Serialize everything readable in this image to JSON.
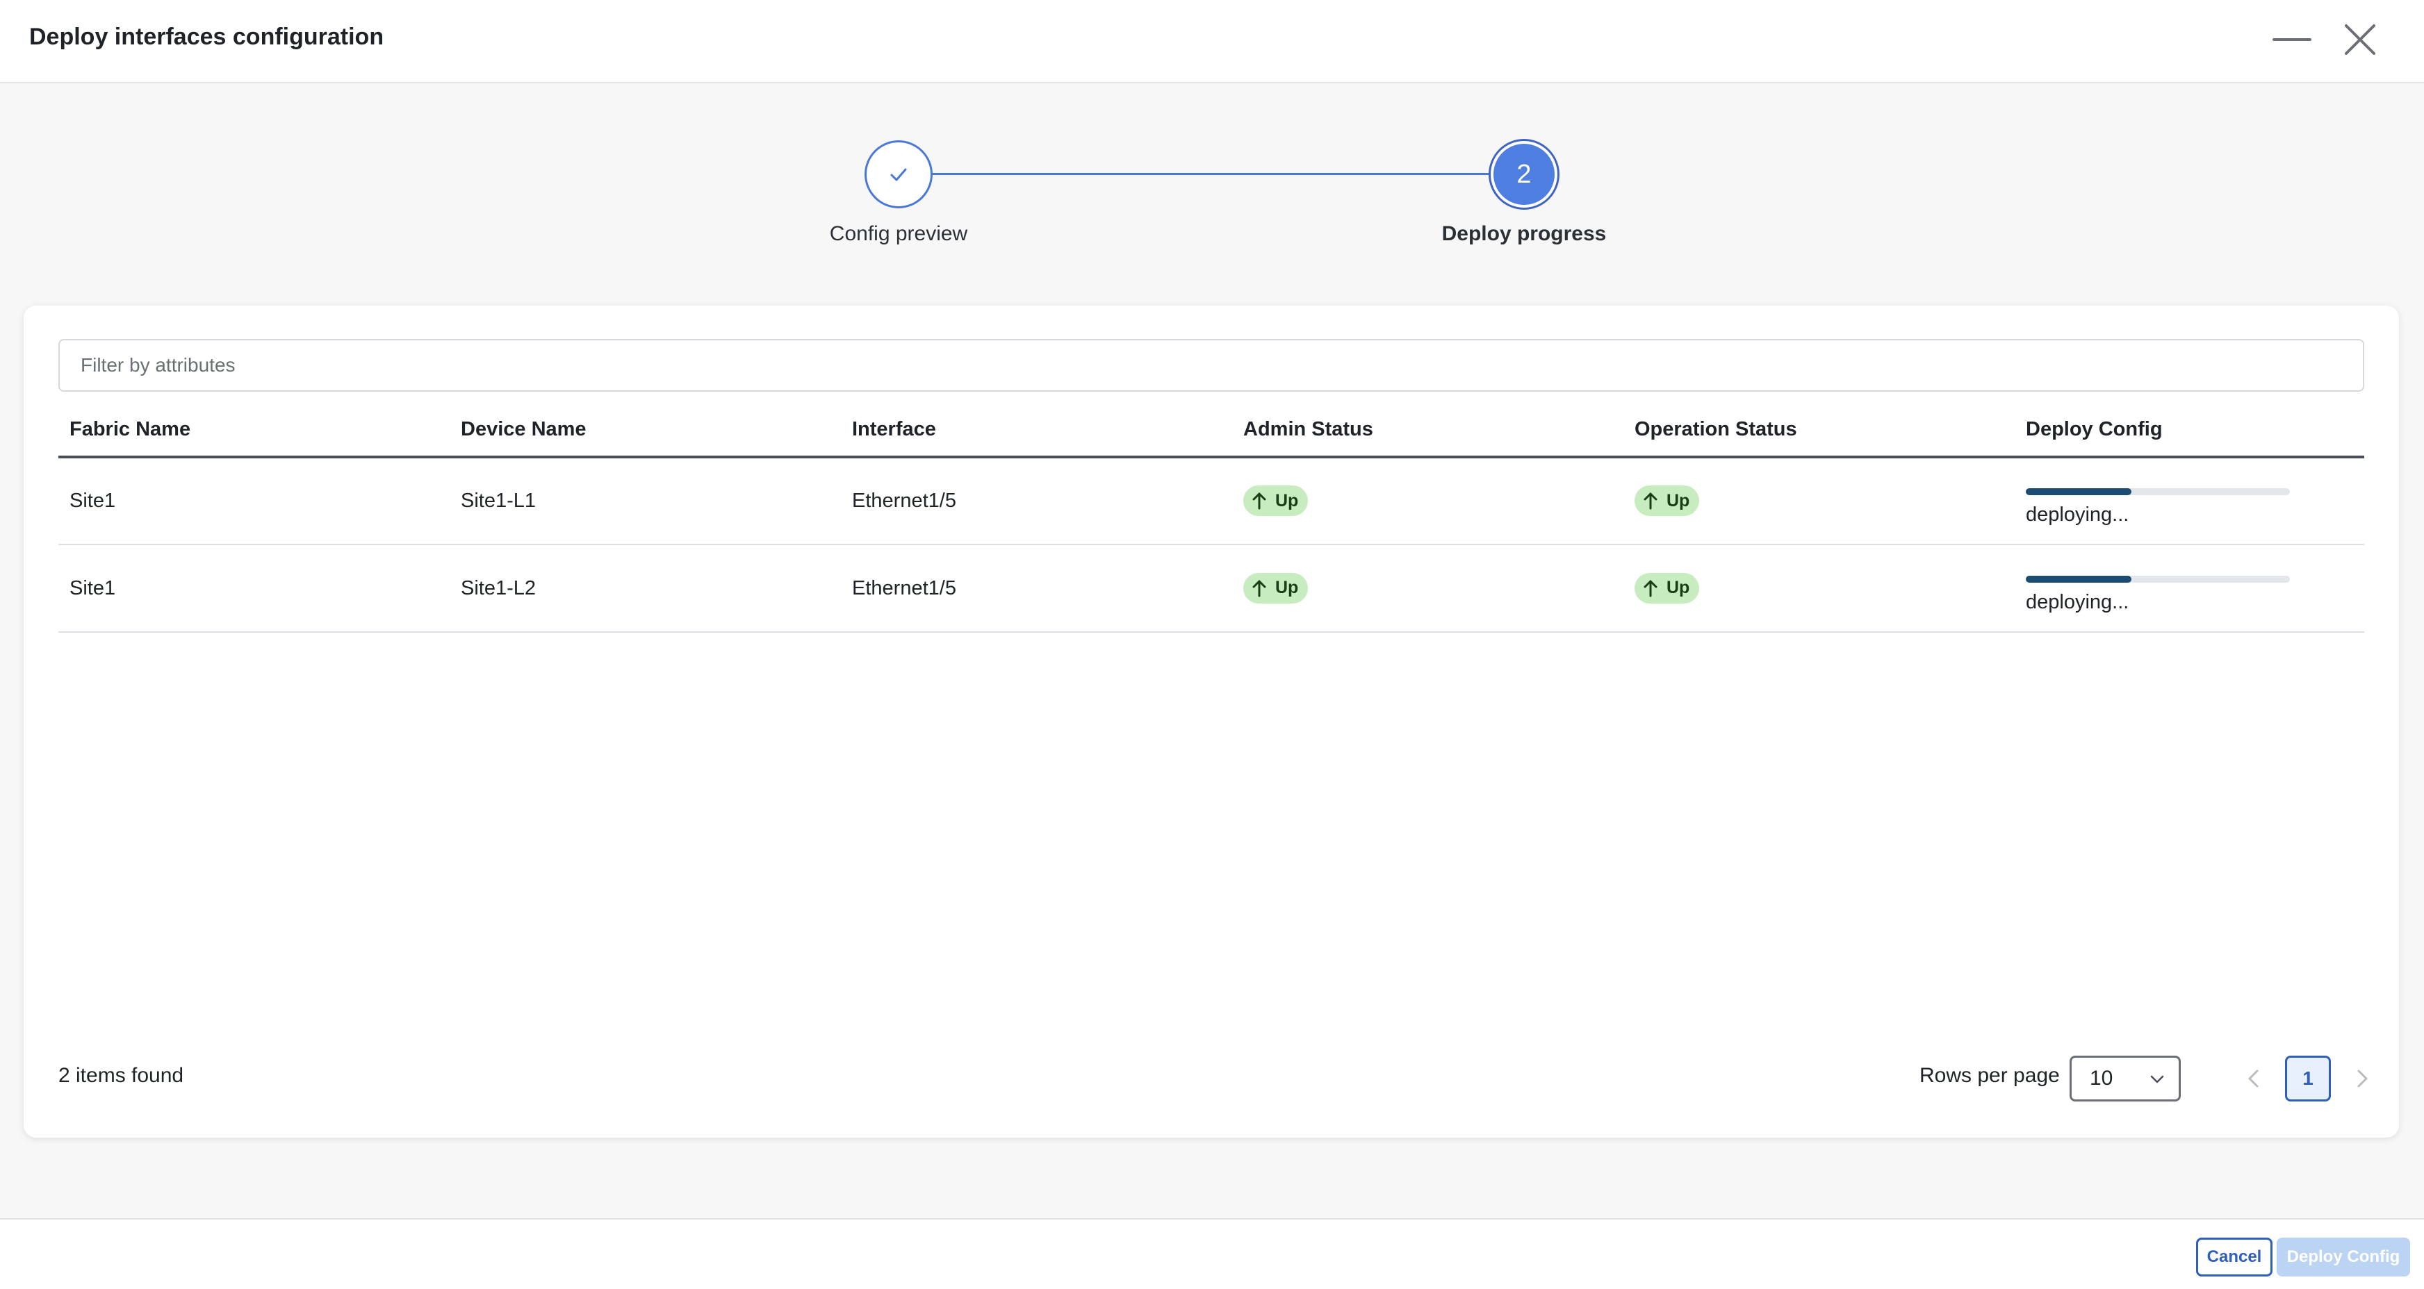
{
  "dialog": {
    "title": "Deploy interfaces configuration",
    "minimize_icon": "minimize-icon",
    "close_icon": "close-icon"
  },
  "stepper": {
    "steps": [
      {
        "label": "Config preview",
        "state": "completed",
        "icon": "checkmark-icon"
      },
      {
        "label": "Deploy progress",
        "state": "active",
        "number": "2"
      }
    ]
  },
  "filter": {
    "placeholder": "Filter by attributes",
    "value": ""
  },
  "table": {
    "columns": [
      "Fabric Name",
      "Device Name",
      "Interface",
      "Admin Status",
      "Operation Status",
      "Deploy Config"
    ],
    "rows": [
      {
        "fabric": "Site1",
        "device": "Site1-L1",
        "interface": "Ethernet1/5",
        "admin_status": "Up",
        "oper_status": "Up",
        "deploy_progress": 0.4,
        "deploy_text": "deploying..."
      },
      {
        "fabric": "Site1",
        "device": "Site1-L2",
        "interface": "Ethernet1/5",
        "admin_status": "Up",
        "oper_status": "Up",
        "deploy_progress": 0.4,
        "deploy_text": "deploying..."
      }
    ]
  },
  "pagination": {
    "items_found": "2 items found",
    "rows_per_page_label": "Rows per page",
    "rows_per_page_value": "10",
    "current_page": "1"
  },
  "footer": {
    "cancel_label": "Cancel",
    "deploy_label": "Deploy Config"
  },
  "colors": {
    "accent": "#4e7fe0",
    "status_up_bg": "#c7ecc0",
    "status_up_fg": "#1a3d16",
    "progress_fill": "#1b4d72",
    "deploy_disabled": "#bcd4f4"
  }
}
